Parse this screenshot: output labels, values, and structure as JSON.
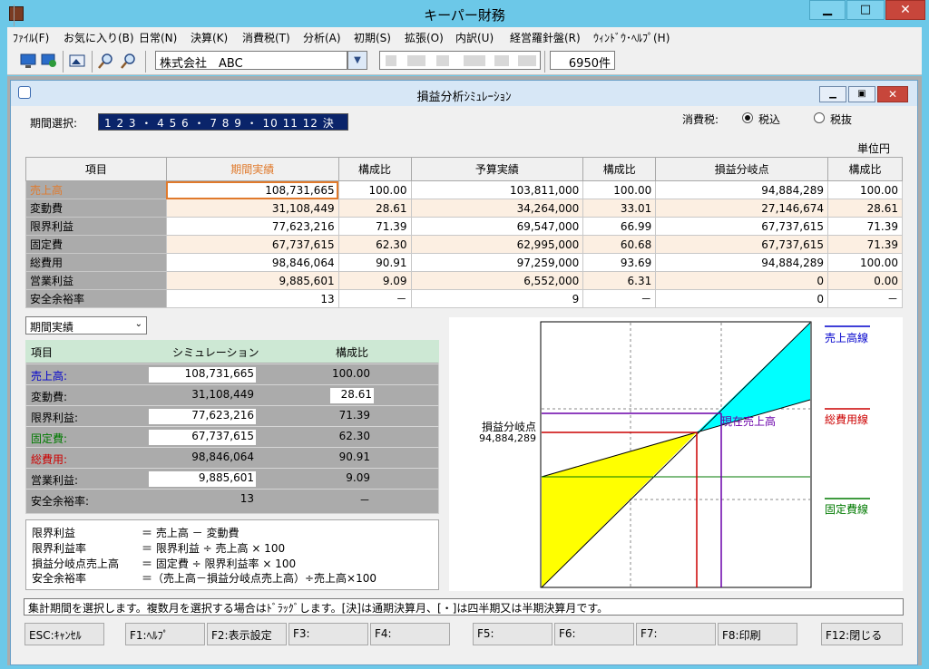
{
  "app": {
    "title": "キーパー財務"
  },
  "menu": [
    "ﾌｧｲﾙ(F)",
    "お気に入り(B)",
    "日常(N)",
    "決算(K)",
    "消費税(T)",
    "分析(A)",
    "初期(S)",
    "拡張(O)",
    "内訳(U)",
    "経営羅針盤(R)",
    "ｳｨﾝﾄﾞｳ･ﾍﾙﾌﾟ(H)"
  ],
  "toolbar": {
    "company": "株式会社　ABC",
    "count": "6950件"
  },
  "window": {
    "title": "損益分析ｼﾐｭﾚｰｼｮﾝ"
  },
  "period": {
    "label": "期間選択:",
    "value": "1 2 3 ・ 4 5 6 ・ 7 8 9 ・ 10 11 12 決"
  },
  "tax": {
    "label": "消費税:",
    "options": [
      "税込",
      "税抜"
    ],
    "selected": "税込"
  },
  "unit": "単位円",
  "table": {
    "headers": [
      "項目",
      "期間実績",
      "構成比",
      "予算実績",
      "構成比",
      "損益分岐点",
      "構成比"
    ],
    "rows": [
      [
        "売上高",
        "108,731,665",
        "100.00",
        "103,811,000",
        "100.00",
        "94,884,289",
        "100.00"
      ],
      [
        "変動費",
        "31,108,449",
        "28.61",
        "34,264,000",
        "33.01",
        "27,146,674",
        "28.61"
      ],
      [
        "限界利益",
        "77,623,216",
        "71.39",
        "69,547,000",
        "66.99",
        "67,737,615",
        "71.39"
      ],
      [
        "固定費",
        "67,737,615",
        "62.30",
        "62,995,000",
        "60.68",
        "67,737,615",
        "71.39"
      ],
      [
        "総費用",
        "98,846,064",
        "90.91",
        "97,259,000",
        "93.69",
        "94,884,289",
        "100.00"
      ],
      [
        "営業利益",
        "9,885,601",
        "9.09",
        "6,552,000",
        "6.31",
        "0",
        "0.00"
      ],
      [
        "安全余裕率",
        "13",
        "－",
        "9",
        "－",
        "0",
        "－"
      ]
    ]
  },
  "basis_select": "期間実績",
  "simulation": {
    "headers": [
      "項目",
      "シミュレーション",
      "構成比"
    ],
    "rows": [
      {
        "label": "売上高:",
        "value": "108,731,665",
        "ratio": "100.00"
      },
      {
        "label": "変動費:",
        "value": "31,108,449",
        "ratio": "28.61"
      },
      {
        "label": "限界利益:",
        "value": "77,623,216",
        "ratio": "71.39"
      },
      {
        "label": "固定費:",
        "value": "67,737,615",
        "ratio": "62.30"
      },
      {
        "label": "総費用:",
        "value": "98,846,064",
        "ratio": "90.91"
      },
      {
        "label": "営業利益:",
        "value": "9,885,601",
        "ratio": "9.09"
      },
      {
        "label": "安全余裕率:",
        "value": "13",
        "ratio": "－"
      }
    ]
  },
  "formulas": [
    {
      "name": "限界利益",
      "expr": "＝ 売上高 － 変動費"
    },
    {
      "name": "限界利益率",
      "expr": "＝ 限界利益 ÷ 売上高 × 100"
    },
    {
      "name": "損益分岐点売上高",
      "expr": "＝ 固定費 ÷ 限界利益率 × 100"
    },
    {
      "name": "安全余裕率",
      "expr": "＝（売上高－損益分岐点売上高）÷売上高×100"
    }
  ],
  "chart": {
    "bep_label": "損益分岐点",
    "bep_value": "94,884,289",
    "current_label": "現在売上高",
    "legend": [
      {
        "label": "売上高線",
        "color": "#0000cc"
      },
      {
        "label": "総費用線",
        "color": "#cc0000"
      },
      {
        "label": "固定費線",
        "color": "#007a00"
      }
    ]
  },
  "status": "集計期間を選択します。複数月を選択する場合はﾄﾞﾗｯｸﾞします。[決]は通期決算月、[・]は四半期又は半期決算月です。",
  "fkeys": [
    "ESC:ｷｬﾝｾﾙ",
    "F1:ﾍﾙﾌﾟ",
    "F2:表示設定",
    "F3:",
    "F4:",
    "F5:",
    "F6:",
    "F7:",
    "F8:印刷",
    "F12:閉じる"
  ]
}
